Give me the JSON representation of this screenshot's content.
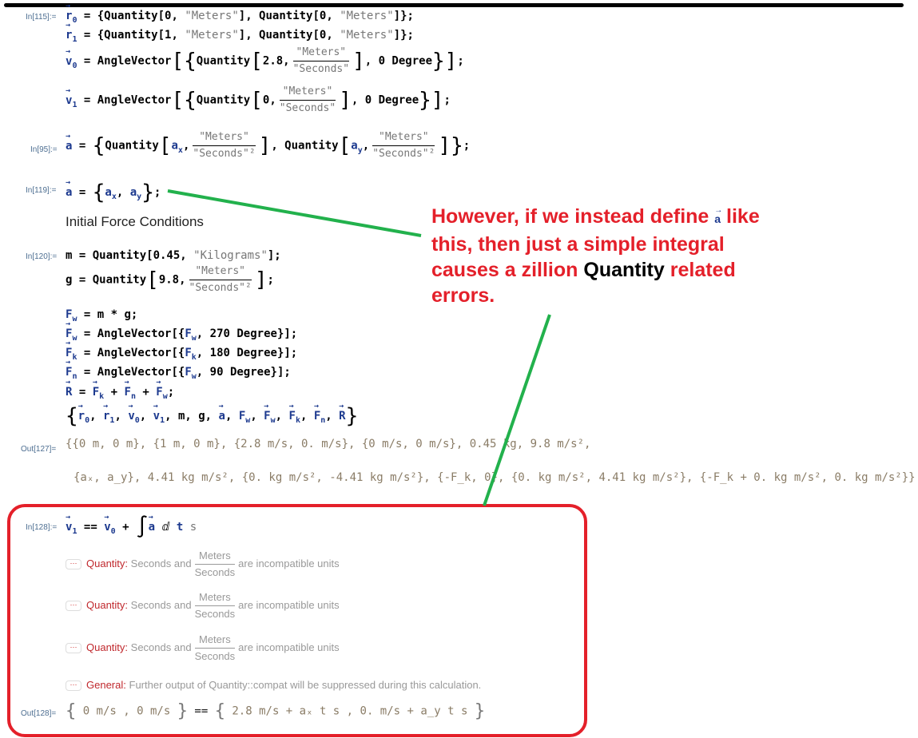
{
  "cells": {
    "in115": {
      "label": "In[115]:=",
      "r0": "r0 = {Quantity[0, \"Meters\"], Quantity[0, \"Meters\"]};",
      "r1": "r1 = {Quantity[1, \"Meters\"], Quantity[0, \"Meters\"]};",
      "v0_prefix": "= AngleVector[{Quantity[2.8,",
      "v0_suffix": "], 0 Degree}];",
      "v1_prefix": "= AngleVector[{Quantity[0,",
      "v1_suffix": "], 0 Degree}];",
      "frac_num": "\"Meters\"",
      "frac_den": "\"Seconds\""
    },
    "in95": {
      "label": "In[95]:=",
      "frac_num": "\"Meters\"",
      "frac_den": "\"Seconds\"²"
    },
    "in119": {
      "label": "In[119]:="
    },
    "section_title": "Initial Force Conditions",
    "in120": {
      "label": "In[120]:=",
      "m_line": "Quantity[0.45, \"Kilograms\"];",
      "g_prefix": "Quantity[9.8,",
      "fw_line": "= m * g;",
      "Fw_vec": "= AngleVector[{F",
      "Fw_angle": ", 270 Degree}];",
      "Fk_angle": ", 180 Degree}];",
      "Fn_angle": ", 90 Degree}];"
    },
    "out127": {
      "label": "Out[127]=",
      "line1": "{{0 m, 0 m}, {1 m, 0 m}, {2.8 m/s, 0. m/s}, {0 m/s, 0 m/s}, 0.45 kg, 9.8 m/s²,",
      "line2": "{aₓ, a_y}, 4.41 kg m/s², {0. kg m/s², -4.41 kg m/s²}, {-F_k, 0}, {0. kg m/s², 4.41 kg m/s²}, {-F_k + 0. kg m/s², 0. kg m/s²}}"
    },
    "in128": {
      "label": "In[128]:="
    },
    "messages": [
      {
        "tag": "Quantity:",
        "pre": "Seconds and",
        "num": "Meters",
        "den": "Seconds",
        "post": "are incompatible units"
      },
      {
        "tag": "Quantity:",
        "pre": "Seconds and",
        "num": "Meters",
        "den": "Seconds",
        "post": "are incompatible units"
      },
      {
        "tag": "Quantity:",
        "pre": "Seconds and",
        "num": "Meters",
        "den": "Seconds",
        "post": "are incompatible units"
      },
      {
        "tag": "General:",
        "pre": "Further output of Quantity::compat will be suppressed during this calculation."
      }
    ],
    "out128": {
      "label": "Out[128]=",
      "lhs": "0 m/s , 0 m/s",
      "rhs": "2.8 m/s + aₓ t s , 0. m/s + a_y t s"
    }
  },
  "annotation": {
    "red_text": "However, if we instead define",
    "symbol": "a",
    "red_text2": "like this, then just a simple integral causes a zillion",
    "black_word": "Quantity",
    "red_text3": "related errors."
  },
  "colors": {
    "annotation_red": "#e4202a",
    "arrow_green": "#22b14c",
    "symbol_blue": "#1d3a8f",
    "message_tag": "#c0282d"
  }
}
